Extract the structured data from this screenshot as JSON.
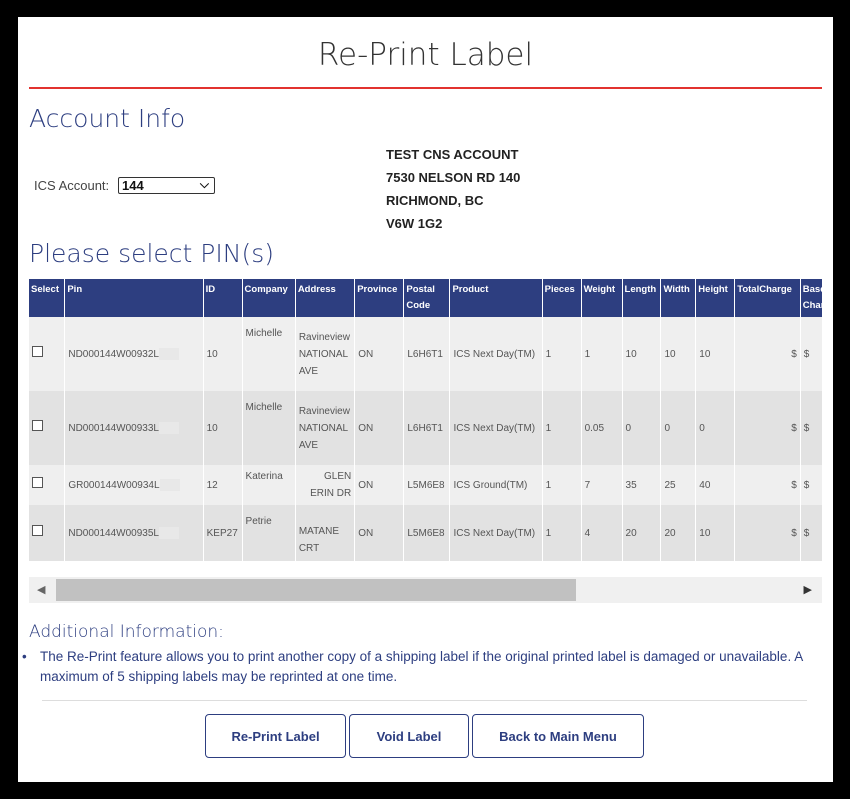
{
  "page_title": "Re-Print Label",
  "account_info": {
    "heading": "Account Info",
    "ics_label": "ICS Account:",
    "ics_value": "144",
    "address_lines": [
      "TEST CNS ACCOUNT",
      "7530 NELSON RD 140",
      "RICHMOND, BC",
      "V6W 1G2"
    ]
  },
  "pins": {
    "heading": "Please select PIN(s)",
    "columns": [
      "Select",
      "Pin",
      "ID",
      "Company",
      "Address",
      "Province",
      "Postal Code",
      "Product",
      "Pieces",
      "Weight",
      "Length",
      "Width",
      "Height",
      "TotalCharge",
      "Base Charge"
    ],
    "rows": [
      {
        "pin": "ND000144W00932L",
        "id": "10",
        "company": "Michelle",
        "address": "Ravineview NATIONAL AVE",
        "province": "ON",
        "postal": "L6H6T1",
        "product": "ICS Next Day(TM)",
        "pieces": "1",
        "weight": "1",
        "length": "10",
        "width": "10",
        "height": "10",
        "total": "$",
        "base": "$"
      },
      {
        "pin": "ND000144W00933L",
        "id": "10",
        "company": "Michelle",
        "address": "Ravineview NATIONAL AVE",
        "province": "ON",
        "postal": "L6H6T1",
        "product": "ICS Next Day(TM)",
        "pieces": "1",
        "weight": "0.05",
        "length": "0",
        "width": "0",
        "height": "0",
        "total": "$",
        "base": "$"
      },
      {
        "pin": "GR000144W00934L",
        "id": "12",
        "company": "Katerina",
        "address": "GLEN ERIN DR",
        "province": "ON",
        "postal": "L5M6E8",
        "product": "ICS Ground(TM)",
        "pieces": "1",
        "weight": "7",
        "length": "35",
        "width": "25",
        "height": "40",
        "total": "$",
        "base": "$"
      },
      {
        "pin": "ND000144W00935L",
        "id": "KEP27",
        "company": "Petrie",
        "address": "MATANE CRT",
        "province": "ON",
        "postal": "L5M6E8",
        "product": "ICS Next Day(TM)",
        "pieces": "1",
        "weight": "4",
        "length": "20",
        "width": "20",
        "height": "10",
        "total": "$",
        "base": "$"
      }
    ]
  },
  "additional": {
    "heading": "Additional Information:",
    "bullet": "The Re-Print feature allows you to print another copy of a shipping label if the original printed label is damaged or unavailable. A maximum of 5 shipping labels may be reprinted at one time."
  },
  "buttons": {
    "reprint": "Re-Print Label",
    "void": "Void Label",
    "back": "Back to Main Menu"
  },
  "icons": {
    "select_chevron": "chevron-down-icon",
    "scroll_left": "triangle-left-icon",
    "scroll_right": "triangle-right-icon"
  },
  "colors": {
    "accent": "#2d3e80",
    "title_rule": "#e2332f",
    "header_bg": "#2d3e80"
  }
}
